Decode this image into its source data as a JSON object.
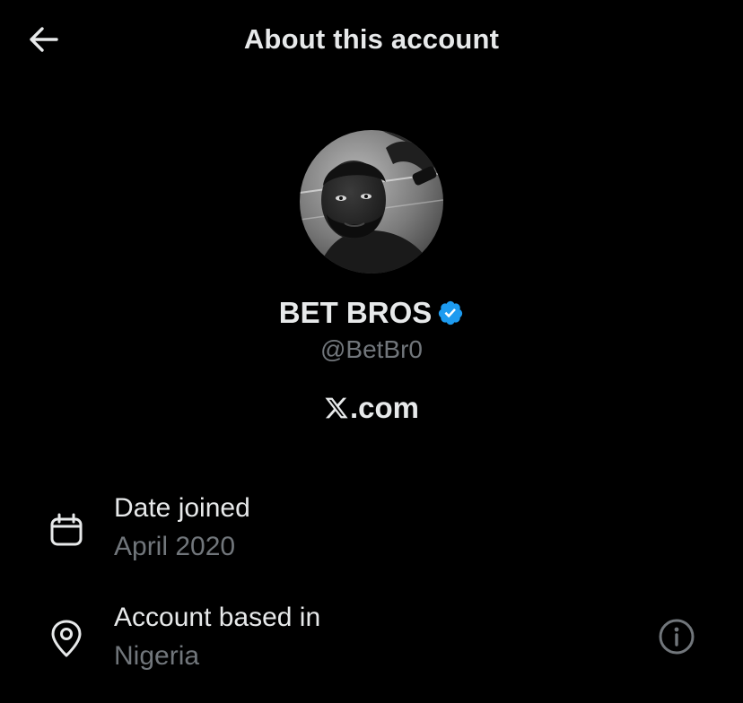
{
  "header": {
    "title": "About this account",
    "back_icon": "arrow-left-icon"
  },
  "profile": {
    "avatar_icon": "profile-photo",
    "display_name": "BET BROS",
    "verified_icon": "verified-badge-icon",
    "handle": "@BetBr0",
    "site_logo": "x-logo-icon",
    "site_text": ".com"
  },
  "details": {
    "date_joined": {
      "icon": "calendar-icon",
      "label": "Date joined",
      "value": "April 2020"
    },
    "based_in": {
      "icon": "location-pin-icon",
      "label": "Account based in",
      "value": "Nigeria",
      "info_icon": "info-icon"
    }
  },
  "colors": {
    "background": "#000000",
    "primary_text": "#e7e9ea",
    "secondary_text": "#71767b",
    "verified_blue": "#1d9bf0"
  }
}
